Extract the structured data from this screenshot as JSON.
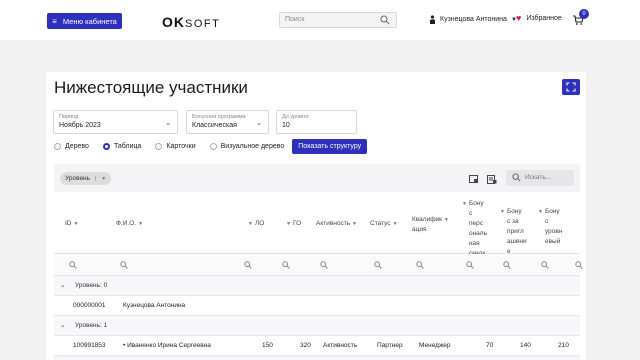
{
  "topbar": {
    "menu_label": "Меню кабинета",
    "logo_o": "O",
    "logo_k": "K",
    "logo_soft": "SOFT",
    "search_placeholder": "Поиск",
    "user_name": "Кузнецова Антонина",
    "favorites_label": "Избранное",
    "cart_count": "0"
  },
  "page": {
    "title": "Нижестоящие участники"
  },
  "filters": {
    "period_label": "Период",
    "period_value": "Ноябрь 2023",
    "bonus_label": "Бонусная программа",
    "bonus_value": "Классическая",
    "level_label": "До уровня:",
    "level_value": "10"
  },
  "views": {
    "options": [
      "Дерево",
      "Таблица",
      "Карточки",
      "Визуальное дерево"
    ],
    "selected": "Таблица",
    "show_button": "Показать структуру"
  },
  "grid": {
    "group_chip": "Уровень",
    "search_placeholder": "Искать...",
    "columns": {
      "id": "ID",
      "fio": "Ф.И.О.",
      "lo": "ЛО",
      "go": "ГО",
      "activity": "Активность",
      "status": "Статус",
      "qual_1": "Квалифик",
      "qual_2": "ация",
      "b1": [
        "Бону",
        "с",
        "перс",
        "ональ",
        "ная",
        "скидк",
        "а"
      ],
      "b2": [
        "Бону",
        "с за",
        "пригл",
        "ашени",
        "е"
      ],
      "b3": [
        "Бону",
        "с",
        "уровн",
        "евый"
      ]
    },
    "groups": [
      {
        "label": "Уровень: 0"
      },
      {
        "label": "Уровень: 1"
      }
    ],
    "rows": [
      {
        "id": "000000001",
        "fio": "Кузнецова Антонина",
        "lo": "",
        "go": "",
        "activity": "",
        "status": "",
        "qual": "",
        "b1": "",
        "b2": "",
        "b3": ""
      },
      {
        "id": "100991853",
        "fio": "• Иваненко Ирина Сергеевна",
        "lo": "150",
        "go": "320",
        "activity": "Активность",
        "status": "Партнер",
        "qual": "Менеджер",
        "b1": "70",
        "b2": "140",
        "b3": "210"
      }
    ]
  },
  "colors": {
    "accent": "#2f2fbd",
    "heart": "#c2185b"
  }
}
